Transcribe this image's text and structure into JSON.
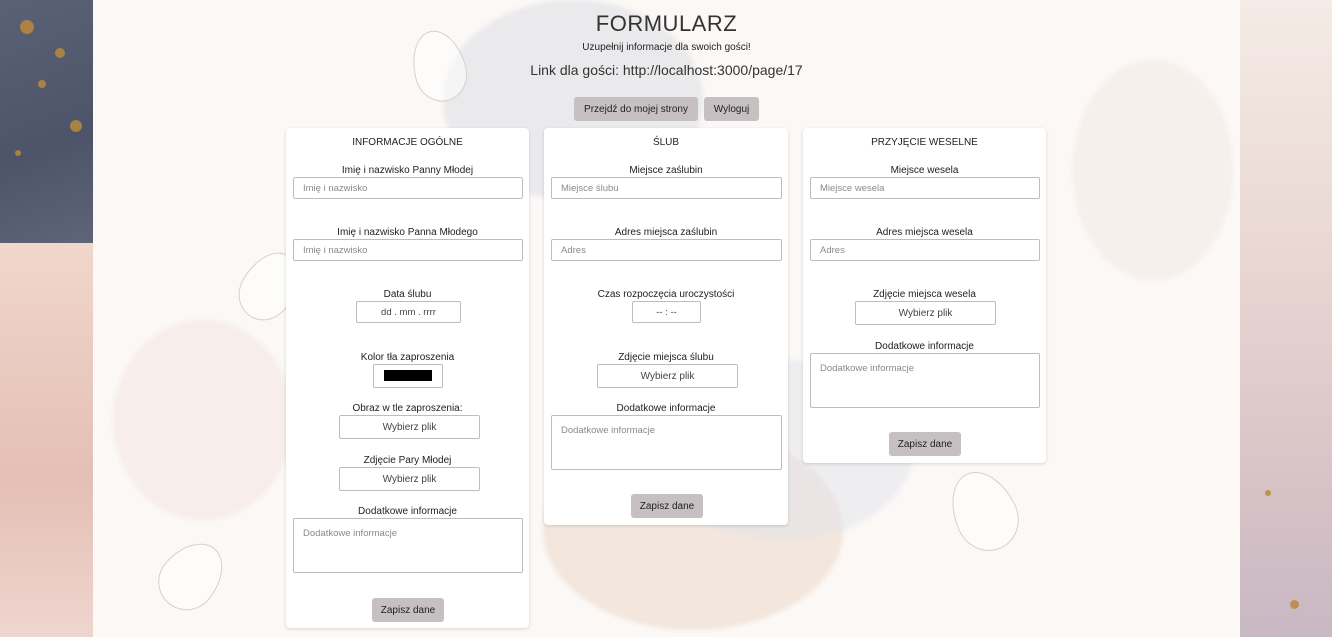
{
  "header": {
    "title": "FORMULARZ",
    "subtitle": "Uzupełnij informacje dla swoich gości!",
    "link_label": "Link dla gości: http://localhost:3000/page/17",
    "my_page_button": "Przejdź do mojej strony",
    "logout_button": "Wyloguj"
  },
  "general": {
    "title": "INFORMACJE OGÓLNE",
    "bride_label": "Imię i nazwisko Panny Młodej",
    "bride_placeholder": "Imię i nazwisko",
    "groom_label": "Imię i nazwisko Panna Młodego",
    "groom_placeholder": "Imię i nazwisko",
    "date_label": "Data ślubu",
    "date_value": "dd . mm . rrrr",
    "color_label": "Kolor tła zaproszenia",
    "color_value": "#000000",
    "bg_image_label": "Obraz w tle zaproszenia:",
    "bg_image_button": "Wybierz plik",
    "couple_photo_label": "Zdjęcie Pary Młodej",
    "couple_photo_button": "Wybierz plik",
    "extra_label": "Dodatkowe informacje",
    "extra_placeholder": "Dodatkowe informacje",
    "save": "Zapisz dane"
  },
  "wedding": {
    "title": "ŚLUB",
    "place_label": "Miejsce zaślubin",
    "place_placeholder": "Miejsce ślubu",
    "address_label": "Adres miejsca zaślubin",
    "address_placeholder": "Adres",
    "time_label": "Czas rozpoczęcia uroczystości",
    "time_value": "-- : --",
    "photo_label": "Zdjęcie miejsca ślubu",
    "photo_button": "Wybierz plik",
    "extra_label": "Dodatkowe informacje",
    "extra_placeholder": "Dodatkowe informacje",
    "save": "Zapisz dane"
  },
  "reception": {
    "title": "PRZYJĘCIE WESELNE",
    "place_label": "Miejsce wesela",
    "place_placeholder": "Miejsce wesela",
    "address_label": "Adres miejsca wesela",
    "address_placeholder": "Adres",
    "photo_label": "Zdjęcie miejsca wesela",
    "photo_button": "Wybierz plik",
    "extra_label": "Dodatkowe informacje",
    "extra_placeholder": "Dodatkowe informacje",
    "save": "Zapisz dane"
  }
}
